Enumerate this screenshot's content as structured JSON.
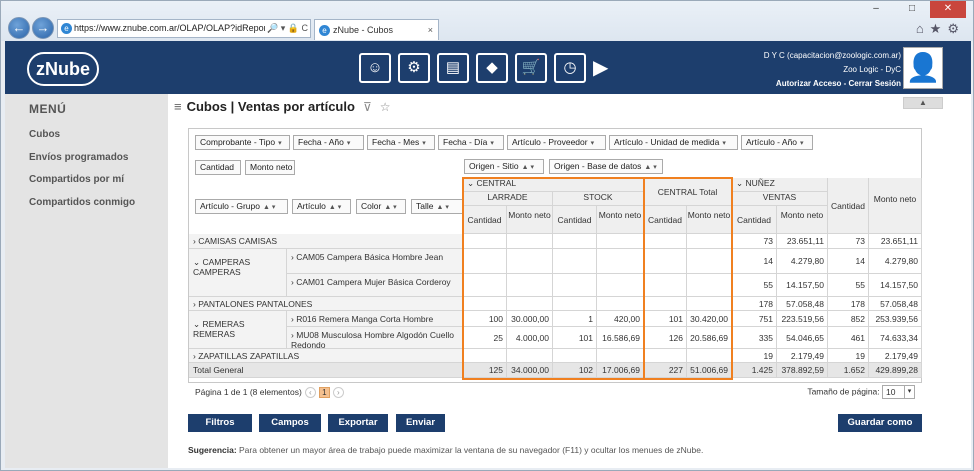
{
  "browser": {
    "url": "https://www.znube.com.ar/OLAP/OLAP?idReport=",
    "tab_title": "zNube - Cubos",
    "back": "←",
    "forward": "→",
    "addr_controls": "🔎 ▾ 🔒 C",
    "tab_close": "×",
    "minimize": "–",
    "maximize": "□",
    "close": "✕",
    "toolbar_icons": "⌂★⚙"
  },
  "header": {
    "logo": "zNube",
    "modules": [
      "☺",
      "⚙",
      "▤",
      "◆",
      "🛒",
      "◷"
    ],
    "more": "▶",
    "user_line1": "D Y C (capacitacion@zoologic.com.ar)",
    "user_line2": "Zoo Logic - DyC",
    "auth_link": "Autorizar Acceso",
    "separator": " - ",
    "logout_link": "Cerrar Sesión",
    "avatar": "👤"
  },
  "sidebar": {
    "title": "MENÚ",
    "items": [
      "Cubos",
      "Envíos programados",
      "Compartidos por mí",
      "Compartidos conmigo"
    ]
  },
  "page": {
    "menu_icon": "≡",
    "title": "Cubos | Ventas por artículo",
    "filter_icon": "⊽",
    "star_icon": "☆",
    "collapse": "▲"
  },
  "pivot": {
    "filter_fields": [
      "Comprobante - Tipo",
      "Fecha - Año",
      "Fecha - Mes",
      "Fecha - Día",
      "Artículo - Proveedor",
      "Artículo - Unidad de medida",
      "Artículo - Año"
    ],
    "data_fields": [
      "Cantidad",
      "Monto neto"
    ],
    "column_fields": [
      "Origen - Sitio",
      "Origen - Base de datos"
    ],
    "row_fields": [
      "Artículo - Grupo",
      "Artículo",
      "Color",
      "Talle"
    ],
    "col_groups": {
      "central": "CENTRAL",
      "larrade": "LARRADE",
      "stock": "STOCK",
      "central_total": "CENTRAL Total",
      "nunez": "NUÑEZ",
      "ventas": "VENTAS",
      "grand_cantidad": "Cantidad",
      "grand_monto": "Monto neto"
    },
    "measure_labels": {
      "cantidad": "Cantidad",
      "monto": "Monto neto"
    },
    "rows": [
      {
        "group": "CAMISAS CAMISAS",
        "article": "",
        "values": [
          "",
          "",
          "",
          "",
          "",
          "",
          "73",
          "23.651,11",
          "73",
          "23.651,11"
        ]
      },
      {
        "group": "CAMPERAS CAMPERAS",
        "article": "CAM05 Campera Básica Hombre Jean",
        "values": [
          "",
          "",
          "",
          "",
          "",
          "",
          "14",
          "4.279,80",
          "14",
          "4.279,80"
        ]
      },
      {
        "group": "",
        "article": "CAM01 Campera Mujer Básica Corderoy",
        "values": [
          "",
          "",
          "",
          "",
          "",
          "",
          "55",
          "14.157,50",
          "55",
          "14.157,50"
        ]
      },
      {
        "group": "PANTALONES PANTALONES",
        "article": "",
        "values": [
          "",
          "",
          "",
          "",
          "",
          "",
          "178",
          "57.058,48",
          "178",
          "57.058,48"
        ]
      },
      {
        "group": "REMERAS REMERAS",
        "article": "R016 Remera Manga Corta Hombre",
        "values": [
          "100",
          "30.000,00",
          "1",
          "420,00",
          "101",
          "30.420,00",
          "751",
          "223.519,56",
          "852",
          "253.939,56"
        ]
      },
      {
        "group": "",
        "article": "MU08 Musculosa Hombre Algodón Cuello Redondo",
        "values": [
          "25",
          "4.000,00",
          "101",
          "16.586,69",
          "126",
          "20.586,69",
          "335",
          "54.046,65",
          "461",
          "74.633,34"
        ]
      },
      {
        "group": "ZAPATILLAS ZAPATILLAS",
        "article": "",
        "values": [
          "",
          "",
          "",
          "",
          "",
          "",
          "19",
          "2.179,49",
          "19",
          "2.179,49"
        ]
      }
    ],
    "total_label": "Total General",
    "totals": [
      "125",
      "34.000,00",
      "102",
      "17.006,69",
      "227",
      "51.006,69",
      "1.425",
      "378.892,59",
      "1.652",
      "429.899,28"
    ],
    "pager_text": "Página 1 de 1 (8 elementos)",
    "pager_prev": "‹",
    "pager_next": "›",
    "current_page": "1",
    "page_size_label": "Tamaño de página:",
    "page_size": "10"
  },
  "actions": {
    "filtros": "Filtros",
    "campos": "Campos",
    "exportar": "Exportar",
    "enviar": "Enviar",
    "guardar": "Guardar como"
  },
  "hint": {
    "label": "Sugerencia:",
    "text": " Para obtener un mayor área de trabajo puede maximizar la ventana de su navegador (F11) y ocultar los menues de zNube."
  }
}
